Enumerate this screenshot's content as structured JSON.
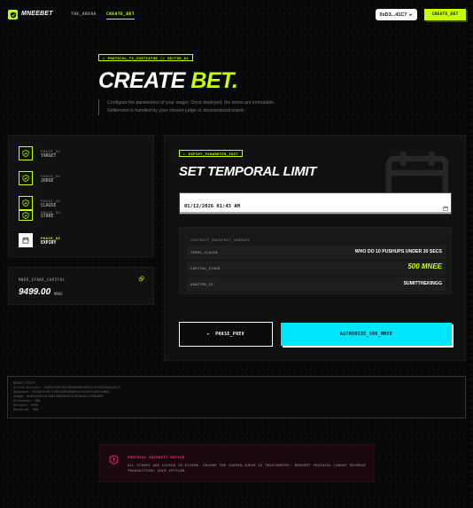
{
  "header": {
    "logo_text": "MNEEBET",
    "nav": [
      {
        "label": "THE_ARENA"
      },
      {
        "label": "CREATE_BET"
      }
    ],
    "wallet_label": "0xD3...41C7",
    "create_label": "CREATE_BET"
  },
  "hero": {
    "tag": "PROTOCOL_TX_INITIATOR // SECTOR_01",
    "title_white": "CREATE",
    "title_green": "BET.",
    "desc_line1": "Configure the parameters of your wager. Once deployed, the terms are immutable.",
    "desc_line2": "Settlement is handled by your chosen judge or decentralized oracle."
  },
  "phases": [
    {
      "num": "PHASE_01",
      "name": "TARGET"
    },
    {
      "num": "PHASE_02",
      "name": "JUDGE"
    },
    {
      "num": "PHASE_03",
      "name": "CLAUSE"
    },
    {
      "num": "PHASE_04",
      "name": "STAKE"
    },
    {
      "num": "PHASE_05",
      "name": "EXPIRY"
    }
  ],
  "capital": {
    "label": "MNEE_STAKE_CAPITAL",
    "value": "9499.00",
    "unit": "MNEE"
  },
  "main": {
    "tag": "EXPIRY_PARAMETER_INIT",
    "title": "SET TEMPORAL LIMIT",
    "date_value": "01/12/2026 01:43 AM",
    "summary_header": "CONTRACT_MANIFEST_SUMMARY",
    "summary_rows": [
      {
        "label": "TERMS_CLAUSE",
        "value": "WHO DO 10 PUSHUPS UNDER 30 SECS"
      },
      {
        "label": "CAPITAL_STAKE",
        "value": "500 MNEE"
      },
      {
        "label": "ARBITER_ID",
        "value": "SUMITTHEKINGG"
      }
    ],
    "prev_label": "PHASE_PREV",
    "authorize_label": "AUTHORIZE_500_MNEE"
  },
  "debug": {
    "lines": [
      "DEBUG_STATE:",
      "Active Account: 0xD3a7E6f1b2C8309d8EfA5C4f1e7A9c2b4c41C7",
      "Opponent: 0x5aE4c9D7f2B1e3A6C8d0F4b7E2a9C1d3F5e8b6",
      "Judge: 0xB7e2A9f4C1d8E3b6F0a5C2e7D9b4A1f3E8c6D0",
      "Allowance: 500",
      "Balance: 9499",
      "Required: 500"
    ]
  },
  "notice": {
    "title": "PROTOCOL SECURITY NOTICE",
    "text": "ALL STAKES ARE LOCKED IN ESCROW. ENSURE THE CHOSEN JUDGE IS TRUSTWORTHY. MNEEBET PROTOCOL CANNOT REVERSE TRANSACTIONS ONCE SETTLED."
  },
  "colors": {
    "accent": "#c6ff00",
    "cyan": "#00e5ff",
    "danger": "#ff2f86",
    "background": "#080808"
  },
  "icons": {
    "logo": "shield-icon",
    "wallet": "chevron-down-icon",
    "phase_done": "check-shield-icon",
    "phase_active": "calendar-icon",
    "capital": "coins-icon",
    "date": "calendar-icon",
    "prev": "arrow-left-icon",
    "notice": "shield-alert-icon"
  }
}
